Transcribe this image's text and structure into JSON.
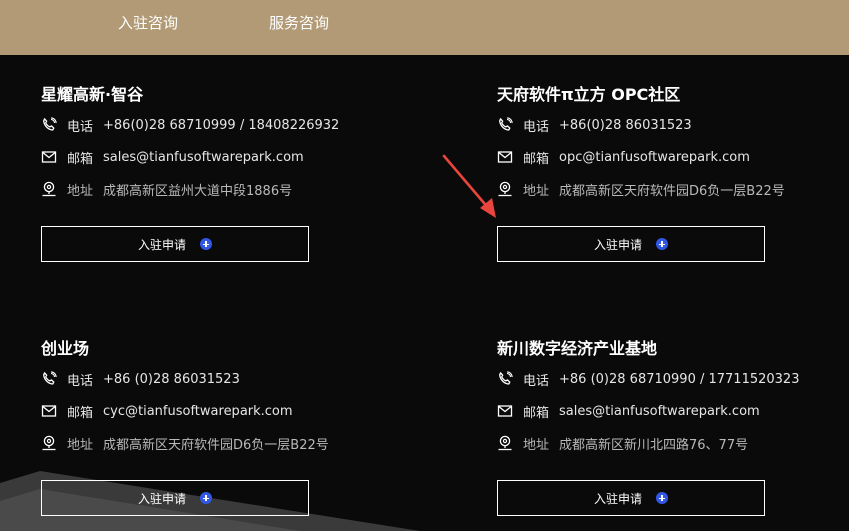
{
  "header": {
    "nav": [
      {
        "label": "入驻咨询"
      },
      {
        "label": "服务咨询"
      }
    ]
  },
  "cards": [
    {
      "title": "星耀高新·智谷",
      "phone_label": "电话",
      "phone": "+86(0)28 68710999 / 18408226932",
      "email_label": "邮箱",
      "email": "sales@tianfusoftwarepark.com",
      "address_label": "地址",
      "address": "成都高新区益州大道中段1886号",
      "button": "入驻申请"
    },
    {
      "title": "天府软件π立方 OPC社区",
      "phone_label": "电话",
      "phone": "+86(0)28 86031523",
      "email_label": "邮箱",
      "email": "opc@tianfusoftwarepark.com",
      "address_label": "地址",
      "address": "成都高新区天府软件园D6负一层B22号",
      "button": "入驻申请"
    },
    {
      "title": "创业场",
      "phone_label": "电话",
      "phone": "+86 (0)28 86031523",
      "email_label": "邮箱",
      "email": "cyc@tianfusoftwarepark.com",
      "address_label": "地址",
      "address": "成都高新区天府软件园D6负一层B22号",
      "button": "入驻申请"
    },
    {
      "title": "新川数字经济产业基地",
      "phone_label": "电话",
      "phone": "+86 (0)28 68710990 / 17711520323",
      "email_label": "邮箱",
      "email": "sales@tianfusoftwarepark.com",
      "address_label": "地址",
      "address": "成都高新区新川北四路76、77号",
      "button": "入驻申请"
    }
  ],
  "colors": {
    "header_bg": "#b29a76",
    "page_bg": "#0a0a0a",
    "plus_icon": "#3057e6",
    "annotation_arrow": "#e8463c"
  },
  "icons": [
    "phone-icon",
    "mail-icon",
    "location-icon",
    "plus-circle-icon"
  ]
}
